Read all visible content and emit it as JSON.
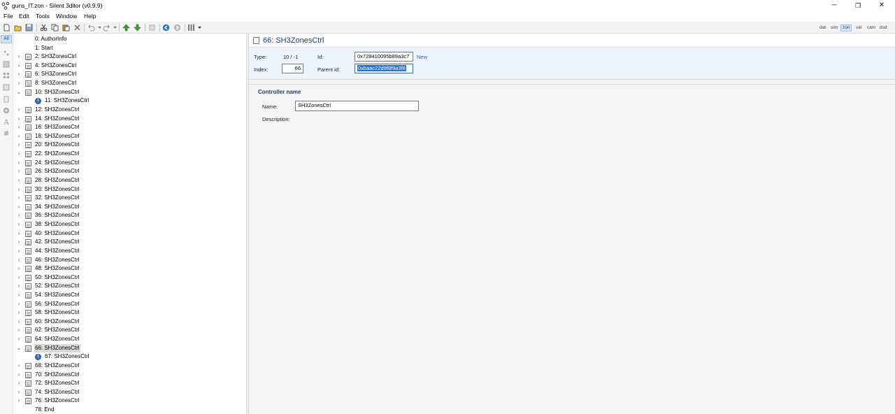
{
  "window": {
    "title": "guns_IT.zon - Silent 3ditor (v0.9.9)",
    "min_glyph": "─",
    "restore_glyph": "❐",
    "close_glyph": "✕"
  },
  "menu": [
    "File",
    "Edit",
    "Tools",
    "Window",
    "Help"
  ],
  "toolbar": {
    "icons": [
      "new-file-icon",
      "open-folder-icon",
      "save-icon",
      "cut-icon",
      "copy-icon",
      "paste-icon",
      "delete-icon",
      "undo-icon",
      "redo-icon",
      "move-up-icon",
      "move-down-icon",
      "disabled-icon",
      "back-icon",
      "forward-icon",
      "columns-icon"
    ],
    "modes": [
      {
        "label": "dat",
        "active": false
      },
      {
        "label": "sim",
        "active": false
      },
      {
        "label": "zon",
        "active": true
      },
      {
        "label": "val",
        "active": false
      },
      {
        "label": "cam",
        "active": false
      },
      {
        "label": "dsd",
        "active": false
      }
    ]
  },
  "left_strip": {
    "all_label": "All",
    "icons": [
      "shape-icon",
      "dots-icon",
      "cube-icon",
      "grid-icon",
      "list-icon",
      "doc-icon",
      "gear-icon",
      "text-icon",
      "block-icon"
    ]
  },
  "tree": [
    {
      "label": "0: AuthorInfo",
      "level": 0,
      "expander": "",
      "icon": "none"
    },
    {
      "label": "1: Start",
      "level": 0,
      "expander": "",
      "icon": "none"
    },
    {
      "label": "2: SH3ZonesCtrl",
      "level": 0,
      "expander": "›",
      "icon": "doc"
    },
    {
      "label": "4: SH3ZonesCtrl",
      "level": 0,
      "expander": "›",
      "icon": "doc"
    },
    {
      "label": "6: SH3ZonesCtrl",
      "level": 0,
      "expander": "›",
      "icon": "doc"
    },
    {
      "label": "8: SH3ZonesCtrl",
      "level": 0,
      "expander": "›",
      "icon": "doc"
    },
    {
      "label": "10: SH3ZonesCtrl",
      "level": 0,
      "expander": "⌄",
      "icon": "doc"
    },
    {
      "label": "11: SH3ZonesCtrl",
      "level": 1,
      "expander": "",
      "icon": "info"
    },
    {
      "label": "12: SH3ZonesCtrl",
      "level": 0,
      "expander": "›",
      "icon": "doc"
    },
    {
      "label": "14: SH3ZonesCtrl",
      "level": 0,
      "expander": "›",
      "icon": "doc"
    },
    {
      "label": "16: SH3ZonesCtrl",
      "level": 0,
      "expander": "›",
      "icon": "doc"
    },
    {
      "label": "18: SH3ZonesCtrl",
      "level": 0,
      "expander": "›",
      "icon": "doc"
    },
    {
      "label": "20: SH3ZonesCtrl",
      "level": 0,
      "expander": "›",
      "icon": "doc"
    },
    {
      "label": "22: SH3ZonesCtrl",
      "level": 0,
      "expander": "›",
      "icon": "doc"
    },
    {
      "label": "24: SH3ZonesCtrl",
      "level": 0,
      "expander": "›",
      "icon": "doc"
    },
    {
      "label": "26: SH3ZonesCtrl",
      "level": 0,
      "expander": "›",
      "icon": "doc"
    },
    {
      "label": "28: SH3ZonesCtrl",
      "level": 0,
      "expander": "›",
      "icon": "doc"
    },
    {
      "label": "30: SH3ZonesCtrl",
      "level": 0,
      "expander": "›",
      "icon": "doc"
    },
    {
      "label": "32: SH3ZonesCtrl",
      "level": 0,
      "expander": "›",
      "icon": "doc"
    },
    {
      "label": "34: SH3ZonesCtrl",
      "level": 0,
      "expander": "›",
      "icon": "doc"
    },
    {
      "label": "36: SH3ZonesCtrl",
      "level": 0,
      "expander": "›",
      "icon": "doc"
    },
    {
      "label": "38: SH3ZonesCtrl",
      "level": 0,
      "expander": "›",
      "icon": "doc"
    },
    {
      "label": "40: SH3ZonesCtrl",
      "level": 0,
      "expander": "›",
      "icon": "doc"
    },
    {
      "label": "42: SH3ZonesCtrl",
      "level": 0,
      "expander": "›",
      "icon": "doc"
    },
    {
      "label": "44: SH3ZonesCtrl",
      "level": 0,
      "expander": "›",
      "icon": "doc"
    },
    {
      "label": "46: SH3ZonesCtrl",
      "level": 0,
      "expander": "›",
      "icon": "doc"
    },
    {
      "label": "48: SH3ZonesCtrl",
      "level": 0,
      "expander": "›",
      "icon": "doc"
    },
    {
      "label": "50: SH3ZonesCtrl",
      "level": 0,
      "expander": "›",
      "icon": "doc"
    },
    {
      "label": "52: SH3ZonesCtrl",
      "level": 0,
      "expander": "›",
      "icon": "doc"
    },
    {
      "label": "54: SH3ZonesCtrl",
      "level": 0,
      "expander": "›",
      "icon": "doc"
    },
    {
      "label": "56: SH3ZonesCtrl",
      "level": 0,
      "expander": "›",
      "icon": "doc"
    },
    {
      "label": "58: SH3ZonesCtrl",
      "level": 0,
      "expander": "›",
      "icon": "doc"
    },
    {
      "label": "60: SH3ZonesCtrl",
      "level": 0,
      "expander": "›",
      "icon": "doc"
    },
    {
      "label": "62: SH3ZonesCtrl",
      "level": 0,
      "expander": "›",
      "icon": "doc"
    },
    {
      "label": "64: SH3ZonesCtrl",
      "level": 0,
      "expander": "›",
      "icon": "doc"
    },
    {
      "label": "66: SH3ZonesCtrl",
      "level": 0,
      "expander": "⌄",
      "icon": "doc",
      "selected": true
    },
    {
      "label": "67: SH3ZonesCtrl",
      "level": 1,
      "expander": "",
      "icon": "info"
    },
    {
      "label": "68: SH3ZonesCtrl",
      "level": 0,
      "expander": "›",
      "icon": "doc"
    },
    {
      "label": "70: SH3ZonesCtrl",
      "level": 0,
      "expander": "›",
      "icon": "doc"
    },
    {
      "label": "72: SH3ZonesCtrl",
      "level": 0,
      "expander": "›",
      "icon": "doc"
    },
    {
      "label": "74: SH3ZonesCtrl",
      "level": 0,
      "expander": "›",
      "icon": "doc"
    },
    {
      "label": "76: SH3ZonesCtrl",
      "level": 0,
      "expander": "›",
      "icon": "doc"
    },
    {
      "label": "78: End",
      "level": 0,
      "expander": "",
      "icon": "none"
    }
  ],
  "detail": {
    "header_title": "66: SH3ZonesCtrl",
    "type_label": "Type:",
    "type_value": "10 / -1",
    "id_label": "Id:",
    "id_value": "0x728410095b89a3c7",
    "new_link": "New",
    "index_label": "Index:",
    "index_value": "66",
    "parent_label": "Parent id:",
    "parent_value": "0xbaac22d9f8f9a3f8",
    "section_title": "Controller name",
    "name_label": "Name:",
    "name_value": "SH3ZonesCtrl",
    "description_label": "Description:"
  },
  "colors": {
    "accent": "#2a6fcb",
    "header_text": "#1d3f73",
    "props_bg": "#eef4fb",
    "selection": "#d9d9d9"
  }
}
